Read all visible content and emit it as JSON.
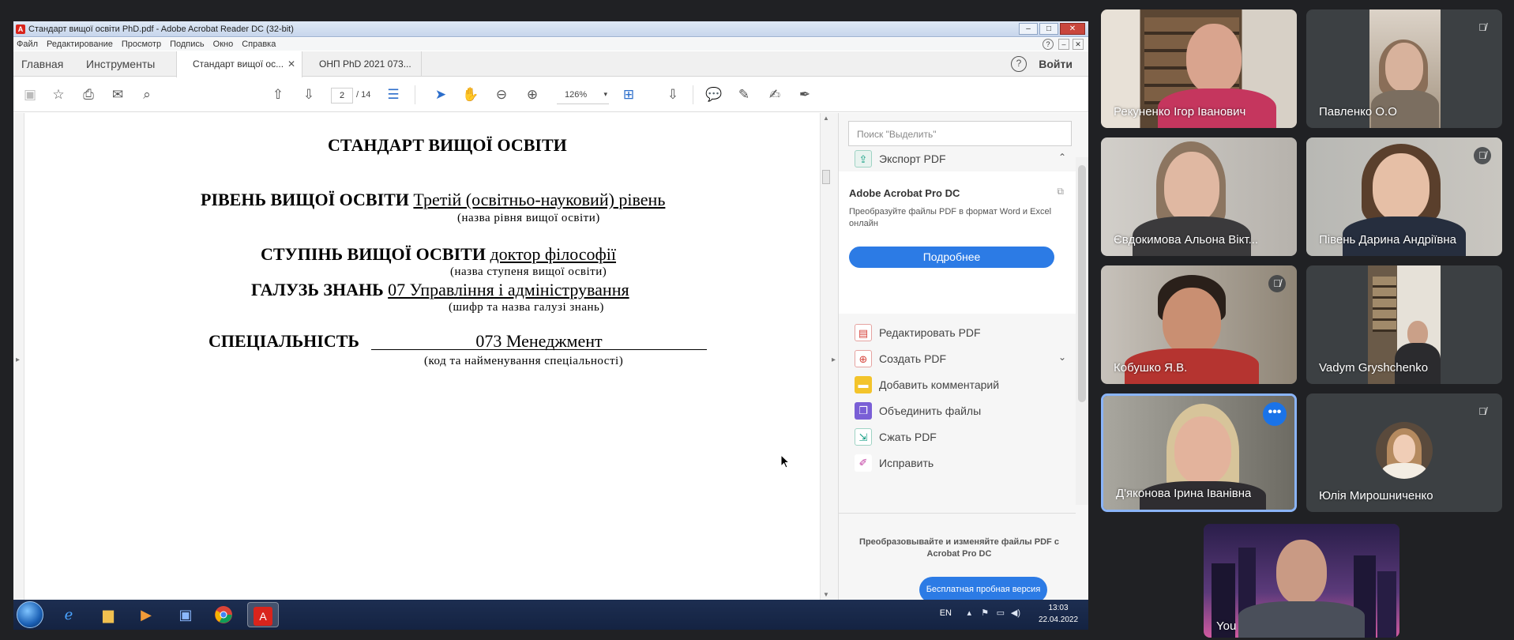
{
  "acrobat": {
    "window_title": "Стандарт вищої освіти PhD.pdf - Adobe Acrobat Reader DC (32-bit)",
    "menu": [
      "Файл",
      "Редактирование",
      "Просмотр",
      "Подпись",
      "Окно",
      "Справка"
    ],
    "tabs": {
      "home": "Главная",
      "tools": "Инструменты",
      "doc_active": "Стандарт вищої ос...",
      "doc_other": "ОНП PhD 2021 073...",
      "signin": "Войти"
    },
    "toolbar": {
      "current_page": "2",
      "total_pages": "/ 14",
      "zoom": "126%"
    },
    "document": {
      "title": "СТАНДАРТ ВИЩОЇ ОСВІТИ",
      "level_label": "РІВЕНЬ ВИЩОЇ ОСВІТИ",
      "level_value": "Третій (освітньо-науковий) рівень",
      "level_hint": "(назва рівня вищої освіти)",
      "degree_label": "СТУПІНЬ ВИЩОЇ ОСВІТИ",
      "degree_value": "доктор філософії",
      "degree_hint": "(назва ступеня вищої освіти)",
      "field_label": "ГАЛУЗЬ ЗНАНЬ",
      "field_value": "07 Управління і адміністрування",
      "field_hint": "(шифр та назва галузі знань)",
      "specialty_label": "СПЕЦІАЛЬНІСТЬ",
      "specialty_value": "073 Менеджмент",
      "specialty_hint": "(код та найменування спеціальності)"
    },
    "tools_pane": {
      "search_placeholder": "Поиск \"Выделить\"",
      "export_pdf": "Экспорт PDF",
      "card_title": "Adobe Acrobat Pro DC",
      "card_text": "Преобразуйте файлы PDF в формат Word и Excel онлайн",
      "card_button": "Подробнее",
      "edit_pdf": "Редактировать PDF",
      "create_pdf": "Создать PDF",
      "add_comment": "Добавить комментарий",
      "combine_files": "Объединить файлы",
      "compress_pdf": "Сжать PDF",
      "fix": "Исправить",
      "promo_text": "Преобразовывайте и изменяйте файлы PDF с Acrobat Pro DC",
      "promo_button": "Бесплатная пробная версия"
    },
    "taskbar": {
      "lang": "EN",
      "time": "13:03",
      "date": "22.04.2022"
    }
  },
  "participants": [
    {
      "name": "Рекуненко Ігор Іванович"
    },
    {
      "name": "Павленко О.О"
    },
    {
      "name": "Євдокимова Альона Вікт..."
    },
    {
      "name": "Півень Дарина Андріївна"
    },
    {
      "name": "Кобушко Я.В."
    },
    {
      "name": "Vadym Gryshchenko"
    },
    {
      "name": "Д'яконова Ірина Іванівна"
    },
    {
      "name": "Юлія Мирошниченко"
    },
    {
      "name": "You"
    }
  ],
  "colors": {
    "meet_background": "#202124",
    "tile_background": "#3c4043",
    "speaking_border": "#8ab4f8",
    "acrobat_blue": "#2c7be5",
    "acrobat_red": "#d9241c"
  },
  "icons": {
    "muted": "mic-off-icon",
    "more_options": "more-options-icon"
  }
}
